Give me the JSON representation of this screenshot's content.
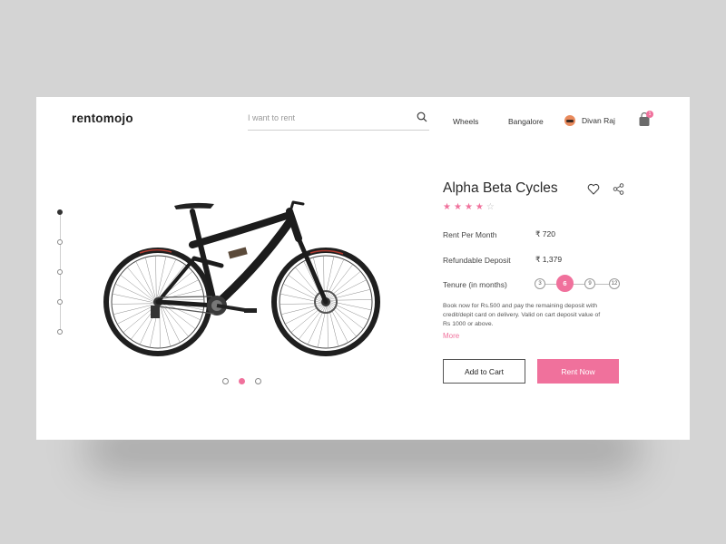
{
  "header": {
    "logo": "rentomojo",
    "search_placeholder": "I want to rent",
    "nav_category": "Wheels",
    "nav_city": "Bangalore",
    "user_name": "Divan Raj",
    "cart_count": "1"
  },
  "product": {
    "title": "Alpha Beta Cycles",
    "rating": 4,
    "rating_max": 5,
    "rent_label": "Rent Per Month",
    "rent_value": "₹ 720",
    "deposit_label": "Refundable Deposit",
    "deposit_value": "₹ 1,379",
    "tenure_label": "Tenure (in months)",
    "tenure_options": [
      "3",
      "6",
      "9",
      "12"
    ],
    "tenure_selected": "6",
    "note": "Book now for Rs.500 and pay the remaining deposit with credit/depit card on delivery. Valid on cart deposit value of Rs 1000 or above.",
    "more_label": "More",
    "add_to_cart_label": "Add to Cart",
    "rent_now_label": "Rent Now"
  },
  "gallery": {
    "thumbnails": 5,
    "active_thumbnail": 1,
    "carousel_dots": 3,
    "active_dot": 2
  },
  "colors": {
    "accent": "#f0719c",
    "background": "#d4d4d4",
    "card": "#ffffff",
    "text": "#333333"
  },
  "icons": [
    "search-icon",
    "avatar",
    "cart-icon",
    "heart-icon",
    "share-icon",
    "star-icon",
    "bicycle-image"
  ]
}
